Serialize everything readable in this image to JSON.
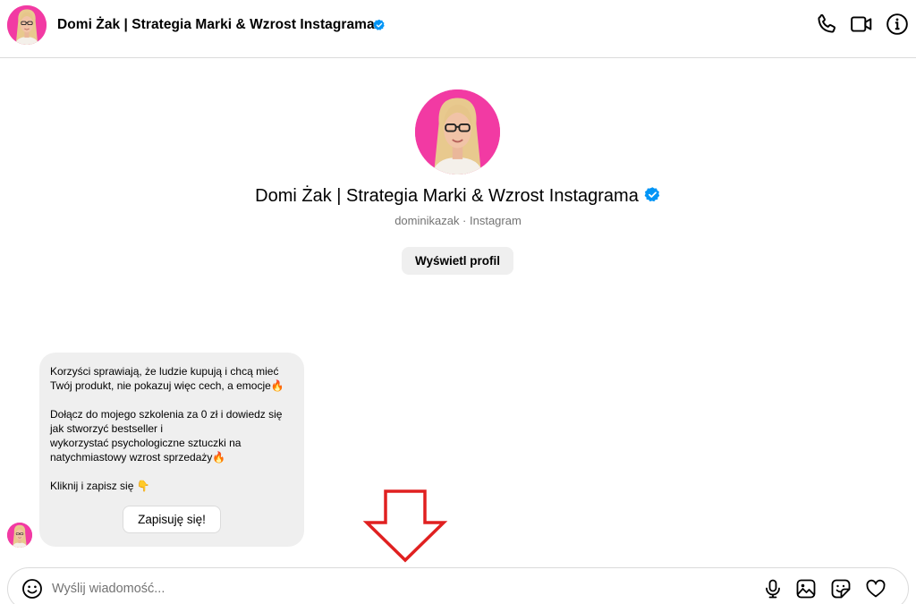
{
  "header": {
    "title": "Domi Żak | Strategia Marki & Wzrost Instagrama"
  },
  "profile": {
    "name": "Domi Żak | Strategia Marki & Wzrost Instagrama",
    "subtitle": "dominikazak · Instagram",
    "view_profile_label": "Wyświetl profil"
  },
  "message": {
    "line1": "Korzyści sprawiają, że ludzie kupują i chcą mieć",
    "line2": "Twój produkt, nie pokazuj więc cech, a emocje",
    "line3": "Dołącz do mojego szkolenia za 0 zł i dowiedz się",
    "line4": "jak stworzyć bestseller i",
    "line5": "wykorzystać psychologiczne sztuczki na",
    "line6": "natychmiastowy wzrost sprzedaży",
    "line7": "Kliknij i zapisz się ",
    "fire_emoji": "🔥",
    "point_emoji": "👇",
    "button_label": "Zapisuję się!"
  },
  "composer": {
    "placeholder": "Wyślij wiadomość..."
  },
  "colors": {
    "avatar_bg": "#f23aa3",
    "verified": "#0095f6",
    "annotation_arrow": "#e02020",
    "bubble_bg": "#efefef",
    "divider": "#dbdbdb"
  },
  "icons": {
    "header": [
      "phone-icon",
      "video-call-icon",
      "info-icon"
    ],
    "composer": [
      "emoji-icon",
      "microphone-icon",
      "image-icon",
      "sticker-icon",
      "heart-icon"
    ],
    "verified": "verified-badge-icon"
  }
}
